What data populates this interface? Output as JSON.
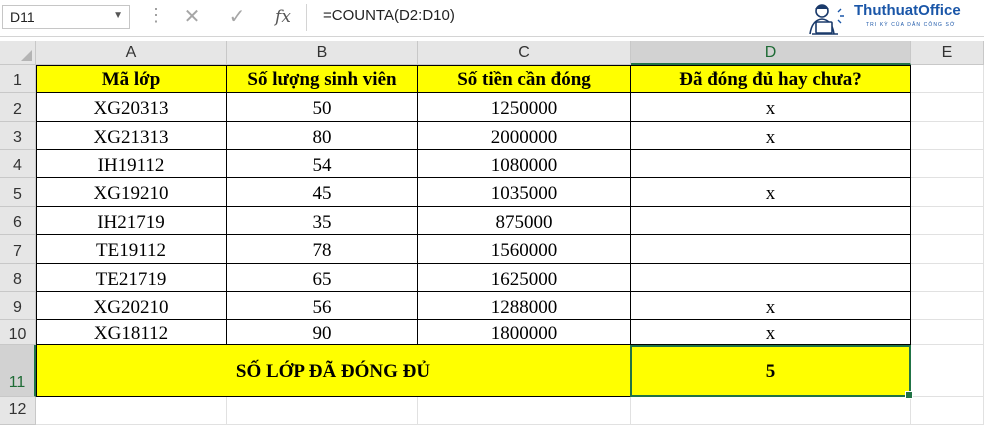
{
  "formula_bar": {
    "name_box": "D11",
    "cancel_icon": "✕",
    "enter_icon": "✓",
    "fx_label": "fx",
    "formula": "=COUNTA(D2:D10)"
  },
  "logo": {
    "name": "ThuthuatOffice",
    "tagline": "TRI KỲ CỦA DÂN CÔNG SỞ"
  },
  "columns": [
    "A",
    "B",
    "C",
    "D",
    "E"
  ],
  "rows": [
    "1",
    "2",
    "3",
    "4",
    "5",
    "6",
    "7",
    "8",
    "9",
    "10",
    "11",
    "12"
  ],
  "sheet": {
    "header": [
      "Mã lớp",
      "Số lượng sinh viên",
      "Số tiền cần đóng",
      "Đã đóng đủ hay chưa?"
    ],
    "data": [
      [
        "XG20313",
        "50",
        "1250000",
        "x"
      ],
      [
        "XG21313",
        "80",
        "2000000",
        "x"
      ],
      [
        "IH19112",
        "54",
        "1080000",
        ""
      ],
      [
        "XG19210",
        "45",
        "1035000",
        "x"
      ],
      [
        "IH21719",
        "35",
        "875000",
        ""
      ],
      [
        "TE19112",
        "78",
        "1560000",
        ""
      ],
      [
        "TE21719",
        "65",
        "1625000",
        ""
      ],
      [
        "XG20210",
        "56",
        "1288000",
        "x"
      ],
      [
        "XG18112",
        "90",
        "1800000",
        "x"
      ]
    ],
    "total_label": "SỐ LỚP ĐÃ ĐÓNG ĐỦ",
    "total_value": "5"
  },
  "colors": {
    "highlight": "#ffff00",
    "selection": "#217346"
  }
}
